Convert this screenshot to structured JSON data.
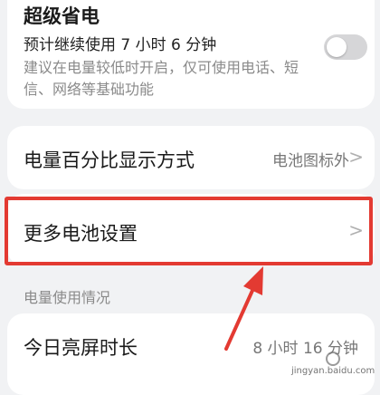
{
  "super_saver": {
    "title": "超级省电",
    "subtitle": "预计继续使用 7 小时 6 分钟",
    "description": "建议在电量较低时开启，仅可使用电话、短信、网络等基础功能",
    "toggle_state": "off"
  },
  "percent_display": {
    "label": "电量百分比显示方式",
    "value": "电池图标外"
  },
  "more_settings": {
    "label": "更多电池设置"
  },
  "usage": {
    "section_title": "电量使用情况",
    "screen_time_label": "今日亮屏时长",
    "screen_time_value": "8 小时 16 分钟"
  },
  "chevron_glyph": ">",
  "annotation_color": "#e33a32",
  "watermark": {
    "text": "jingyan.baidu.com"
  }
}
